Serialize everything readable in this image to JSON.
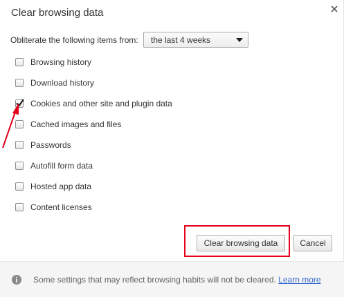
{
  "dialog": {
    "title": "Clear browsing data"
  },
  "range": {
    "label": "Obliterate the following items from:",
    "selected": "the last 4 weeks"
  },
  "options": [
    {
      "label": "Browsing history",
      "checked": false
    },
    {
      "label": "Download history",
      "checked": false
    },
    {
      "label": "Cookies and other site and plugin data",
      "checked": true
    },
    {
      "label": "Cached images and files",
      "checked": false
    },
    {
      "label": "Passwords",
      "checked": false
    },
    {
      "label": "Autofill form data",
      "checked": false
    },
    {
      "label": "Hosted app data",
      "checked": false
    },
    {
      "label": "Content licenses",
      "checked": false
    }
  ],
  "buttons": {
    "clear": "Clear browsing data",
    "cancel": "Cancel"
  },
  "footer": {
    "text": "Some settings that may reflect browsing habits will not be cleared.",
    "link": "Learn more"
  },
  "icons": {
    "close": "close-icon",
    "info": "info-icon",
    "dropdown": "chevron-down-icon",
    "check": "checkmark-icon"
  },
  "colors": {
    "annotation": "#e4001b",
    "link": "#3366cc",
    "footer_bg": "#f5f5f5"
  }
}
